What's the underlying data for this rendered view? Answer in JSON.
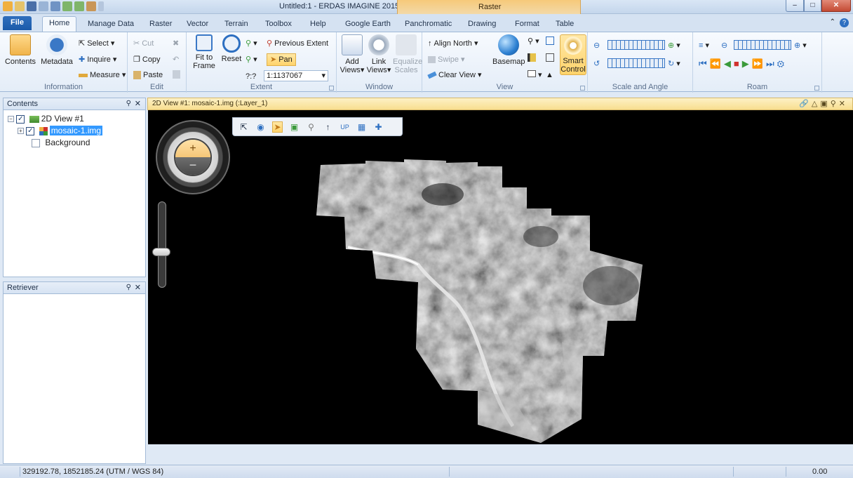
{
  "window": {
    "title": "Untitled:1 - ERDAS IMAGINE 2015",
    "contextual_tab_group": "Raster"
  },
  "tabs": [
    "File",
    "Home",
    "Manage Data",
    "Raster",
    "Vector",
    "Terrain",
    "Toolbox",
    "Help",
    "Google Earth",
    "Panchromatic",
    "Drawing",
    "Format",
    "Table"
  ],
  "ribbon": {
    "information": {
      "label": "Information",
      "contents": "Contents",
      "metadata": "Metadata",
      "select": "Select",
      "inquire": "Inquire",
      "measure": "Measure"
    },
    "edit": {
      "label": "Edit",
      "cut": "Cut",
      "copy": "Copy",
      "paste": "Paste"
    },
    "extent": {
      "label": "Extent",
      "fit_to": "Fit to",
      "frame": "Frame",
      "reset": "Reset",
      "previous_extent": "Previous Extent",
      "pan": "Pan",
      "scale_prefix": "?:?",
      "scale_value": "1:1137067"
    },
    "window": {
      "label": "Window",
      "add": "Add",
      "views": "Views",
      "link": "Link",
      "link_views": "Views",
      "equalize": "Equalize",
      "scales": "Scales"
    },
    "view": {
      "label": "View",
      "align_north": "Align North",
      "swipe": "Swipe",
      "clear_view": "Clear View",
      "basemap": "Basemap",
      "smart": "Smart",
      "control": "Control"
    },
    "scale_and_angle": {
      "label": "Scale and Angle"
    },
    "roam": {
      "label": "Roam"
    }
  },
  "contents_panel": {
    "title": "Contents",
    "items": [
      "2D View #1",
      "mosaic-1.img",
      "Background"
    ]
  },
  "retriever_panel": {
    "title": "Retriever"
  },
  "view": {
    "title": "2D View #1: mosaic-1.img (:Layer_1)"
  },
  "status": {
    "coords": "329192.78, 1852185.24  (UTM / WGS 84)",
    "value": "0.00"
  },
  "colors": {
    "file_tab": "#1b5aa9",
    "contextual_tab": "#f3c57a",
    "view_header": "#f8de8f",
    "selection": "#3399ff"
  }
}
